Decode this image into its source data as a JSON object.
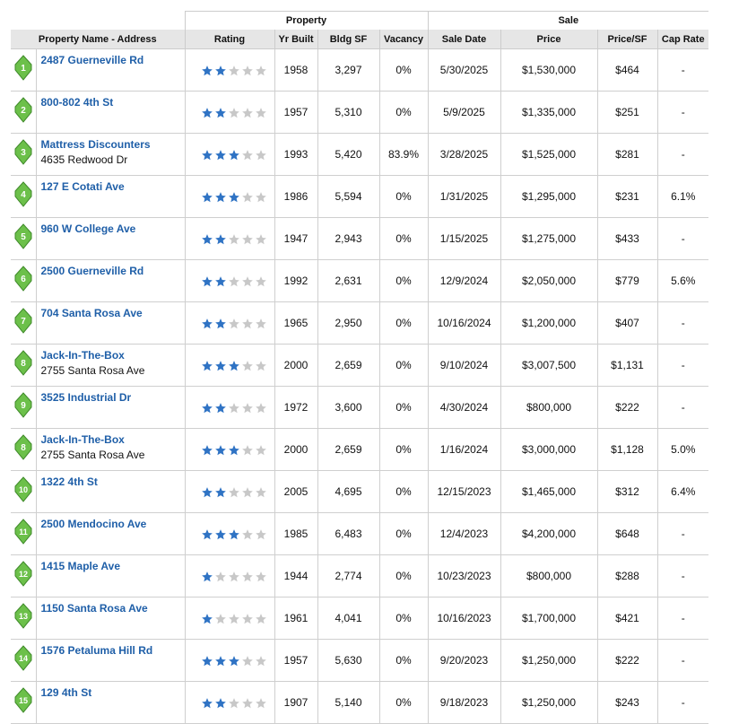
{
  "table": {
    "group_headers": {
      "property": "Property",
      "sale": "Sale"
    },
    "columns": [
      "Property Name - Address",
      "Rating",
      "Yr Built",
      "Bldg SF",
      "Vacancy",
      "Sale Date",
      "Price",
      "Price/SF",
      "Cap Rate"
    ],
    "colors": {
      "marker_fill": "#6cc04a",
      "marker_stroke": "#3f8a2a",
      "star_on": "#2f73c4",
      "star_off": "#c8c8c8",
      "link": "#1f5fa8",
      "header_bg": "#e6e6e6"
    },
    "rows": [
      {
        "marker": "1",
        "name": "2487 Guerneville Rd",
        "address": "",
        "rating": 2,
        "yr_built": "1958",
        "bldg_sf": "3,297",
        "vacancy": "0%",
        "sale_date": "5/30/2025",
        "price": "$1,530,000",
        "price_sf": "$464",
        "cap_rate": "-"
      },
      {
        "marker": "2",
        "name": "800-802 4th St",
        "address": "",
        "rating": 2,
        "yr_built": "1957",
        "bldg_sf": "5,310",
        "vacancy": "0%",
        "sale_date": "5/9/2025",
        "price": "$1,335,000",
        "price_sf": "$251",
        "cap_rate": "-"
      },
      {
        "marker": "3",
        "name": "Mattress Discounters",
        "address": "4635 Redwood Dr",
        "rating": 3,
        "yr_built": "1993",
        "bldg_sf": "5,420",
        "vacancy": "83.9%",
        "sale_date": "3/28/2025",
        "price": "$1,525,000",
        "price_sf": "$281",
        "cap_rate": "-"
      },
      {
        "marker": "4",
        "name": "127 E Cotati Ave",
        "address": "",
        "rating": 3,
        "yr_built": "1986",
        "bldg_sf": "5,594",
        "vacancy": "0%",
        "sale_date": "1/31/2025",
        "price": "$1,295,000",
        "price_sf": "$231",
        "cap_rate": "6.1%"
      },
      {
        "marker": "5",
        "name": "960 W College Ave",
        "address": "",
        "rating": 2,
        "yr_built": "1947",
        "bldg_sf": "2,943",
        "vacancy": "0%",
        "sale_date": "1/15/2025",
        "price": "$1,275,000",
        "price_sf": "$433",
        "cap_rate": "-"
      },
      {
        "marker": "6",
        "name": "2500 Guerneville Rd",
        "address": "",
        "rating": 2,
        "yr_built": "1992",
        "bldg_sf": "2,631",
        "vacancy": "0%",
        "sale_date": "12/9/2024",
        "price": "$2,050,000",
        "price_sf": "$779",
        "cap_rate": "5.6%"
      },
      {
        "marker": "7",
        "name": "704 Santa Rosa Ave",
        "address": "",
        "rating": 2,
        "yr_built": "1965",
        "bldg_sf": "2,950",
        "vacancy": "0%",
        "sale_date": "10/16/2024",
        "price": "$1,200,000",
        "price_sf": "$407",
        "cap_rate": "-"
      },
      {
        "marker": "8",
        "name": "Jack-In-The-Box",
        "address": "2755 Santa Rosa Ave",
        "rating": 3,
        "yr_built": "2000",
        "bldg_sf": "2,659",
        "vacancy": "0%",
        "sale_date": "9/10/2024",
        "price": "$3,007,500",
        "price_sf": "$1,131",
        "cap_rate": "-"
      },
      {
        "marker": "9",
        "name": "3525 Industrial Dr",
        "address": "",
        "rating": 2,
        "yr_built": "1972",
        "bldg_sf": "3,600",
        "vacancy": "0%",
        "sale_date": "4/30/2024",
        "price": "$800,000",
        "price_sf": "$222",
        "cap_rate": "-"
      },
      {
        "marker": "8",
        "name": "Jack-In-The-Box",
        "address": "2755 Santa Rosa Ave",
        "rating": 3,
        "yr_built": "2000",
        "bldg_sf": "2,659",
        "vacancy": "0%",
        "sale_date": "1/16/2024",
        "price": "$3,000,000",
        "price_sf": "$1,128",
        "cap_rate": "5.0%"
      },
      {
        "marker": "10",
        "name": "1322 4th St",
        "address": "",
        "rating": 2,
        "yr_built": "2005",
        "bldg_sf": "4,695",
        "vacancy": "0%",
        "sale_date": "12/15/2023",
        "price": "$1,465,000",
        "price_sf": "$312",
        "cap_rate": "6.4%"
      },
      {
        "marker": "11",
        "name": "2500 Mendocino Ave",
        "address": "",
        "rating": 3,
        "yr_built": "1985",
        "bldg_sf": "6,483",
        "vacancy": "0%",
        "sale_date": "12/4/2023",
        "price": "$4,200,000",
        "price_sf": "$648",
        "cap_rate": "-"
      },
      {
        "marker": "12",
        "name": "1415 Maple Ave",
        "address": "",
        "rating": 1,
        "yr_built": "1944",
        "bldg_sf": "2,774",
        "vacancy": "0%",
        "sale_date": "10/23/2023",
        "price": "$800,000",
        "price_sf": "$288",
        "cap_rate": "-"
      },
      {
        "marker": "13",
        "name": "1150 Santa Rosa Ave",
        "address": "",
        "rating": 1,
        "yr_built": "1961",
        "bldg_sf": "4,041",
        "vacancy": "0%",
        "sale_date": "10/16/2023",
        "price": "$1,700,000",
        "price_sf": "$421",
        "cap_rate": "-"
      },
      {
        "marker": "14",
        "name": "1576 Petaluma Hill Rd",
        "address": "",
        "rating": 3,
        "yr_built": "1957",
        "bldg_sf": "5,630",
        "vacancy": "0%",
        "sale_date": "9/20/2023",
        "price": "$1,250,000",
        "price_sf": "$222",
        "cap_rate": "-"
      },
      {
        "marker": "15",
        "name": "129 4th St",
        "address": "",
        "rating": 2,
        "yr_built": "1907",
        "bldg_sf": "5,140",
        "vacancy": "0%",
        "sale_date": "9/18/2023",
        "price": "$1,250,000",
        "price_sf": "$243",
        "cap_rate": "-"
      }
    ]
  }
}
